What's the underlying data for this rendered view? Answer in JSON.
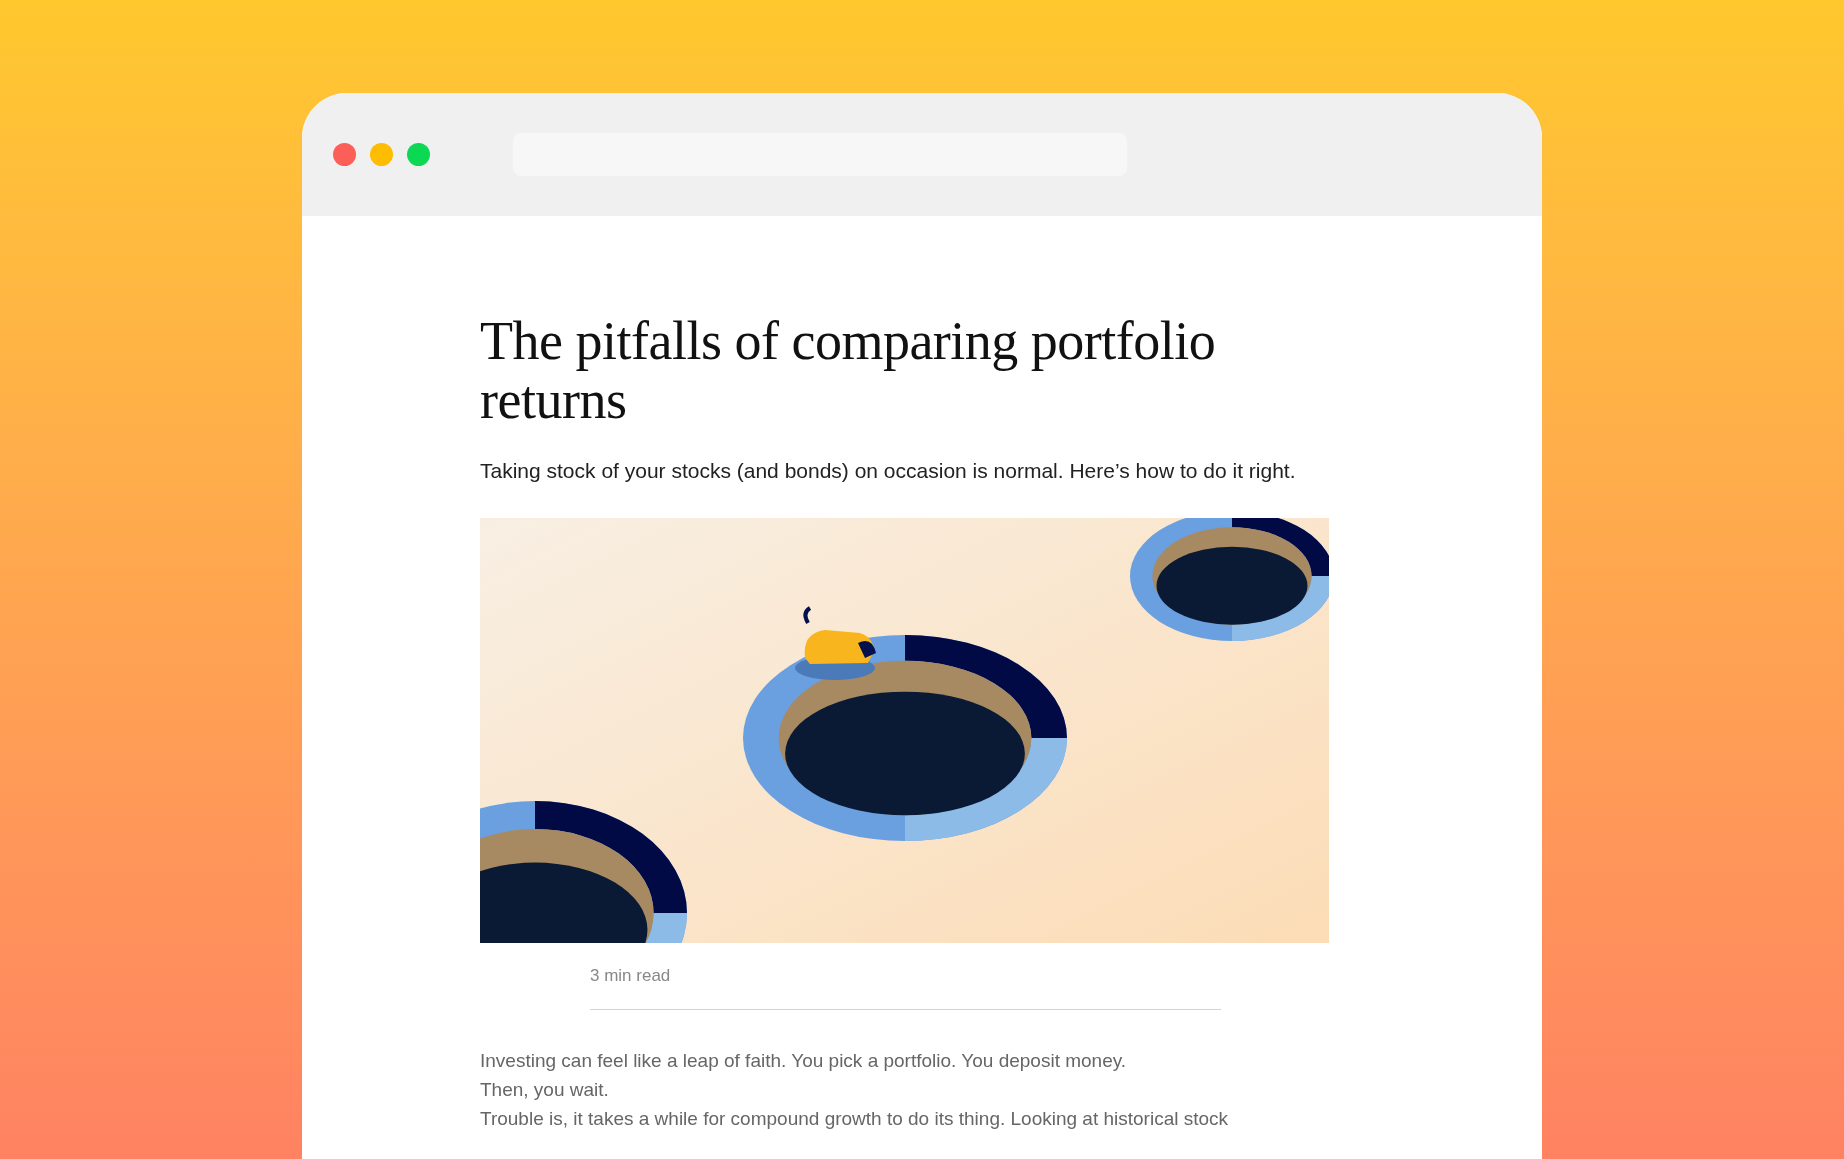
{
  "article": {
    "title": "The pitfalls of comparing portfolio returns",
    "subtitle": "Taking stock of your stocks (and bonds) on occasion is normal. Here’s how to do it right.",
    "read_time": "3 min read",
    "paragraphs": [
      "Investing can feel like a leap of faith. You pick a portfolio. You deposit money.",
      "Then, you wait.",
      "Trouble is, it takes a while for compound growth to do its thing. Looking at historical stock"
    ]
  }
}
